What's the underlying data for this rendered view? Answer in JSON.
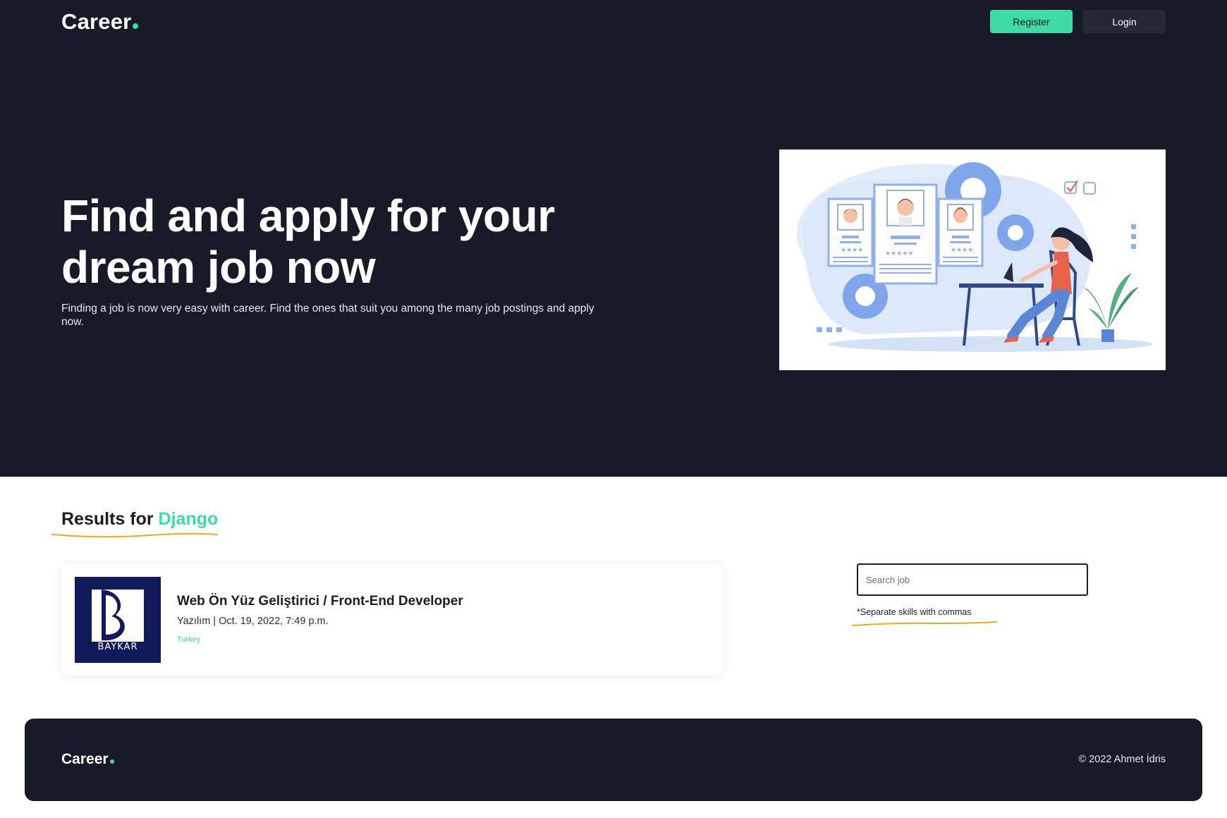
{
  "nav": {
    "brand": "Career",
    "register_label": "Register",
    "login_label": "Login"
  },
  "hero": {
    "headline": "Find and apply for your dream job now",
    "subline": "Finding a job is now very easy with career. Find the ones that suit you among the many job postings and apply now."
  },
  "results": {
    "prefix": "Results for",
    "keyword": "Django"
  },
  "jobs": [
    {
      "title": "Web Ön Yüz Geliştirici / Front-End Developer",
      "meta": "Yazılım | Oct. 19, 2022, 7:49 p.m.",
      "location": "Turkey",
      "company_logo_text": "BAYKAR"
    }
  ],
  "search": {
    "placeholder": "Search job",
    "hint": "*Separate skills with commas"
  },
  "footer": {
    "brand": "Career",
    "copyright": "© 2022 Ahmet İdris"
  },
  "colors": {
    "dark_bg": "#181b27",
    "accent": "#3ddba5",
    "underline": "#f0a818",
    "logo_bg": "#131a5a"
  }
}
